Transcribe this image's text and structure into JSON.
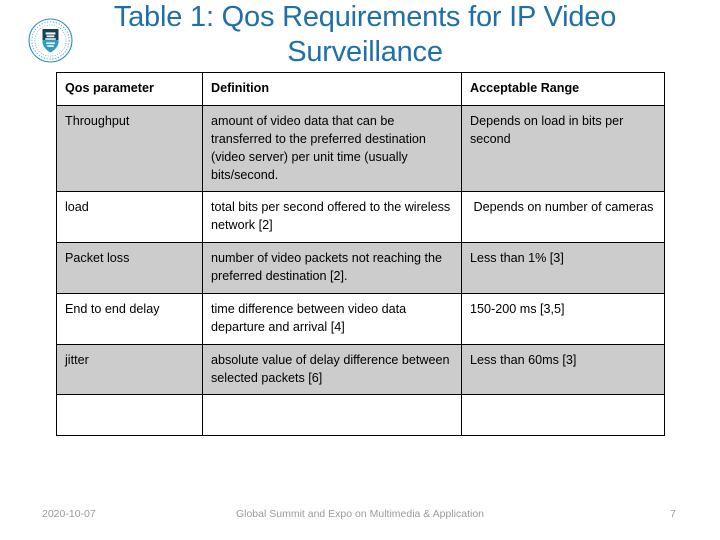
{
  "slide": {
    "title": "Table 1: Qos Requirements for IP Video Surveillance",
    "title_color": "#1f6fa8",
    "logo_icon": "university-seal-icon"
  },
  "table": {
    "name": "qos-requirements-table",
    "headers": [
      "Qos parameter",
      "Definition",
      "Acceptable Range"
    ],
    "rows": [
      {
        "shaded": true,
        "parameter": "Throughput",
        "definition": "amount of video data that can be transferred to the preferred destination (video server) per unit time (usually bits/second.",
        "range": "Depends on load in bits per second"
      },
      {
        "shaded": false,
        "parameter": "load",
        "definition": "total bits per second offered to the wireless network [2]",
        "range": " Depends on number of cameras"
      },
      {
        "shaded": true,
        "parameter": "Packet loss",
        "definition": "number of video packets not reaching the preferred destination [2].",
        "range": "Less than 1% [3]"
      },
      {
        "shaded": false,
        "parameter": "End to end delay",
        "definition": "time difference between video data departure and arrival [4]",
        "range": "150-200 ms [3,5]"
      },
      {
        "shaded": true,
        "parameter": "jitter",
        "definition": "absolute value of delay difference between selected packets [6]",
        "range": "Less than 60ms [3]"
      },
      {
        "shaded": false,
        "empty": true,
        "parameter": "",
        "definition": "",
        "range": ""
      }
    ]
  },
  "footer": {
    "date": "2020-10-07",
    "center": "Global Summit and Expo on Multimedia & Application",
    "page": "7",
    "color": "#9a9a9a"
  }
}
